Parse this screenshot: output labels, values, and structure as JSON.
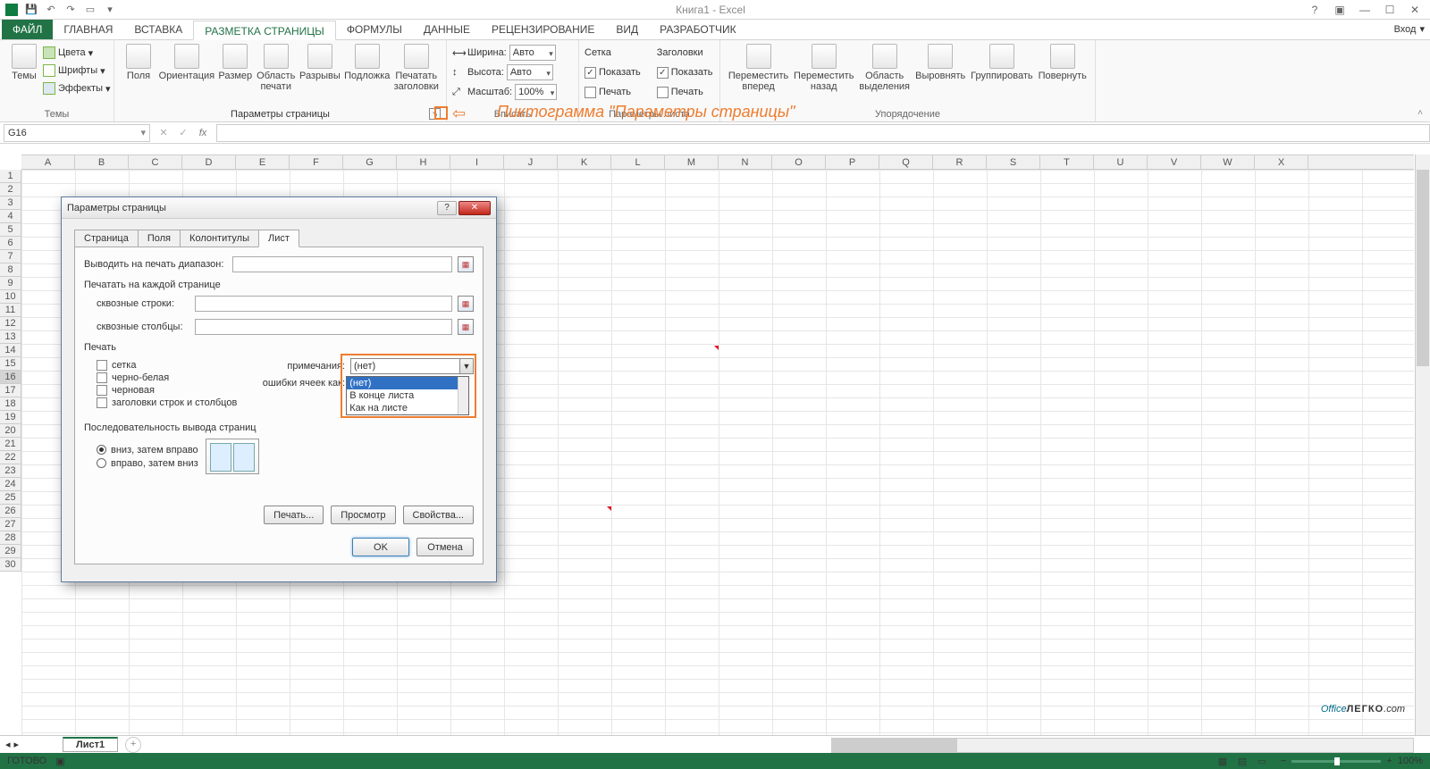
{
  "title": "Книга1 - Excel",
  "tabs": {
    "file": "ФАЙЛ",
    "home": "ГЛАВНАЯ",
    "insert": "ВСТАВКА",
    "layout": "РАЗМЕТКА СТРАНИЦЫ",
    "formulas": "ФОРМУЛЫ",
    "data": "ДАННЫЕ",
    "review": "РЕЦЕНЗИРОВАНИЕ",
    "view": "ВИД",
    "developer": "РАЗРАБОТЧИК",
    "signin": "Вход"
  },
  "ribbon": {
    "themes": {
      "colors": "Цвета",
      "fonts": "Шрифты",
      "effects": "Эффекты",
      "themes": "Темы",
      "group": "Темы"
    },
    "page_setup": {
      "margins": "Поля",
      "orientation": "Ориентация",
      "size": "Размер",
      "print_area": "Область\nпечати",
      "breaks": "Разрывы",
      "background": "Подложка",
      "print_titles": "Печатать\nзаголовки",
      "group": "Параметры страницы"
    },
    "scale": {
      "width": "Ширина:",
      "height": "Высота:",
      "scale": "Масштаб:",
      "auto": "Авто",
      "scale_val": "100%",
      "group": "Вписать"
    },
    "gridlines": {
      "label": "Сетка",
      "show": "Показать",
      "print": "Печать"
    },
    "headings": {
      "label": "Заголовки",
      "show": "Показать",
      "print": "Печать"
    },
    "sheet_opts_group": "Параметры листа",
    "arrange": {
      "forward": "Переместить\nвперед",
      "backward": "Переместить\nназад",
      "selection": "Область\nвыделения",
      "align": "Выровнять",
      "group_btn": "Группировать",
      "rotate": "Повернуть",
      "group": "Упорядочение"
    }
  },
  "annotation": "Пиктограмма \"Параметры страницы\"",
  "namebox": "G16",
  "columns": [
    "A",
    "B",
    "C",
    "D",
    "E",
    "F",
    "G",
    "H",
    "I",
    "J",
    "K",
    "L",
    "M",
    "N",
    "O",
    "P",
    "Q",
    "R",
    "S",
    "T",
    "U",
    "V",
    "W",
    "X"
  ],
  "rows": [
    "1",
    "2",
    "3",
    "4",
    "5",
    "6",
    "7",
    "8",
    "9",
    "10",
    "11",
    "12",
    "13",
    "14",
    "15",
    "16",
    "17",
    "18",
    "19",
    "20",
    "21",
    "22",
    "23",
    "24",
    "25",
    "26",
    "27",
    "28",
    "29",
    "30"
  ],
  "selected_row": "16",
  "sheet": "Лист1",
  "status": {
    "ready": "ГОТОВО",
    "zoom": "100%"
  },
  "dialog": {
    "title": "Параметры страницы",
    "tabs": {
      "page": "Страница",
      "margins": "Поля",
      "header": "Колонтитулы",
      "sheet": "Лист"
    },
    "print_area": "Выводить на печать диапазон:",
    "print_titles": "Печатать на каждой странице",
    "rows_repeat": "сквозные строки:",
    "cols_repeat": "сквозные столбцы:",
    "print": "Печать",
    "gridlines": "сетка",
    "bw": "черно-белая",
    "draft": "черновая",
    "headings": "заголовки строк и столбцов",
    "comments": "примечания:",
    "errors": "ошибки ячеек как:",
    "comments_val": "(нет)",
    "dd": [
      "(нет)",
      "В конце листа",
      "Как на листе"
    ],
    "order": "Последовательность вывода страниц",
    "down_over": "вниз, затем вправо",
    "over_down": "вправо, затем вниз",
    "print_btn": "Печать...",
    "preview": "Просмотр",
    "options": "Свойства...",
    "ok": "OK",
    "cancel": "Отмена"
  },
  "watermark": {
    "office": "Office",
    "legko": "ЛЕГКО",
    "com": ".com"
  }
}
